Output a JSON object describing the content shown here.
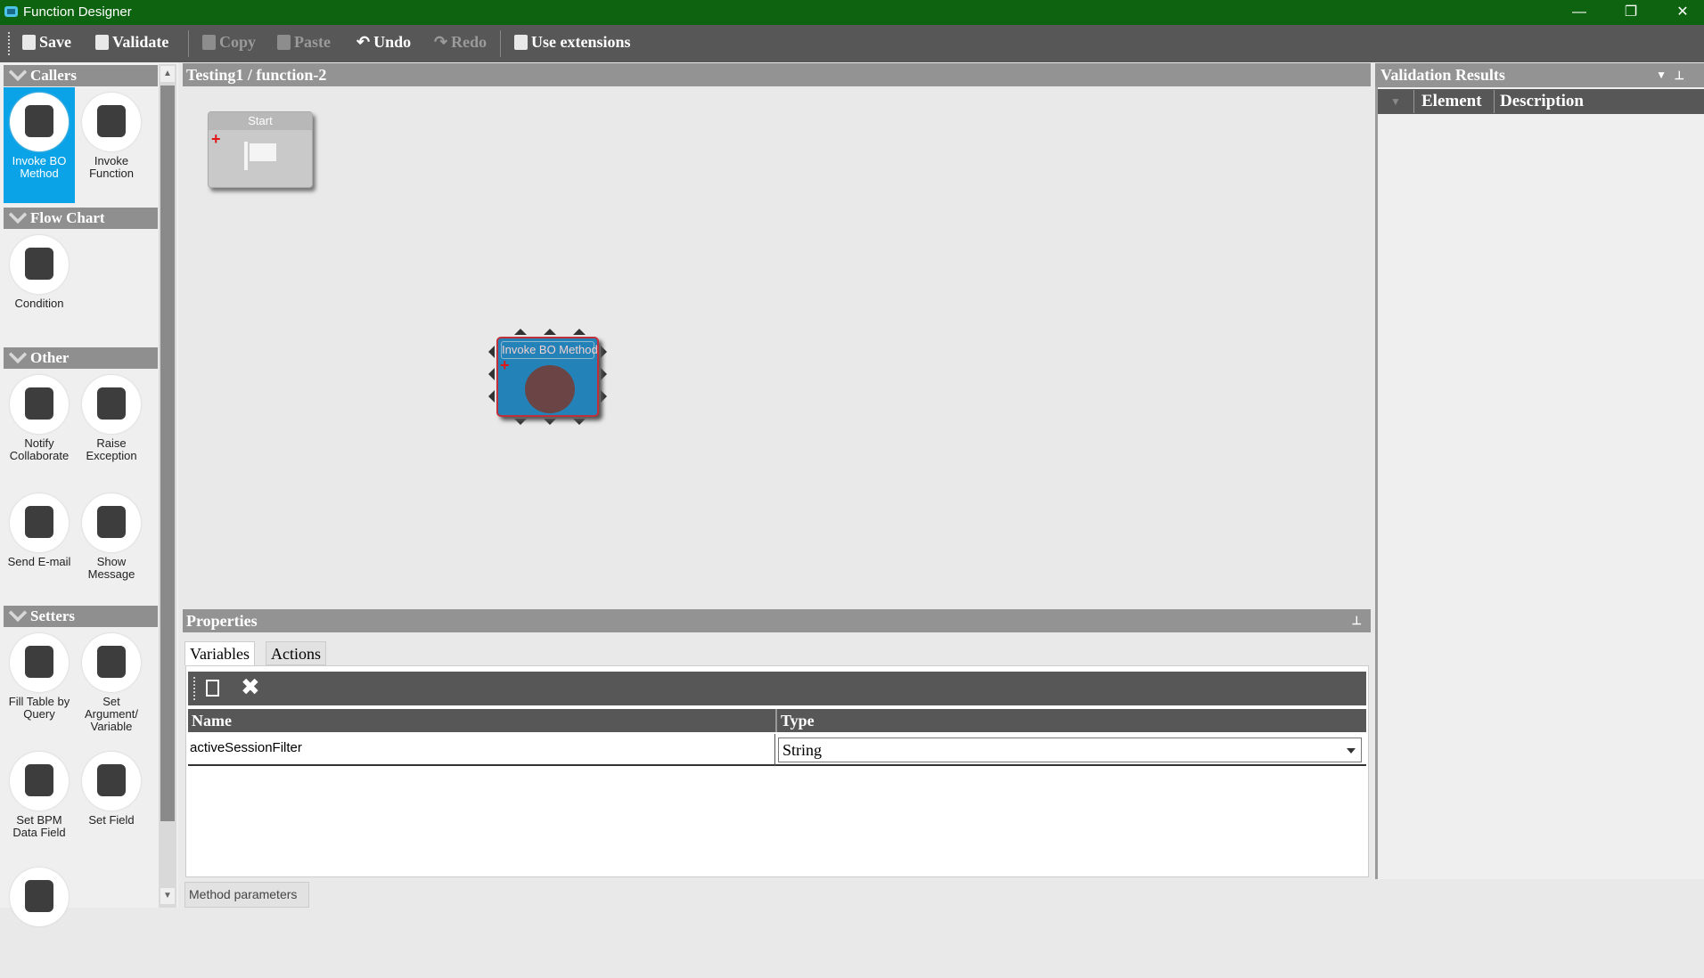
{
  "window": {
    "title": "Function Designer"
  },
  "toolbar": {
    "save": "Save",
    "validate": "Validate",
    "copy": "Copy",
    "paste": "Paste",
    "undo": "Undo",
    "redo": "Redo",
    "use_extensions": "Use extensions"
  },
  "palette": {
    "sections": [
      {
        "title": "Callers",
        "items": [
          "Invoke BO Method",
          "Invoke Function"
        ]
      },
      {
        "title": "Flow Chart",
        "items": [
          "Condition"
        ]
      },
      {
        "title": "Other",
        "items": [
          "Notify Collaborate",
          "Raise Exception",
          "Send E-mail",
          "Show Message"
        ]
      },
      {
        "title": "Setters",
        "items": [
          "Fill Table by Query",
          "Set Argument/ Variable",
          "Set BPM Data Field",
          "Set Field"
        ]
      }
    ]
  },
  "canvas": {
    "breadcrumb": "Testing1 / function-2",
    "nodes": {
      "start": "Start",
      "invoke": "Invoke BO Method"
    }
  },
  "properties": {
    "title": "Properties",
    "tabs": [
      "Variables",
      "Actions"
    ],
    "columns": [
      "Name",
      "Type"
    ],
    "rows": [
      {
        "name": "activeSessionFilter",
        "type": "String"
      }
    ]
  },
  "bottom_tab": "Method parameters",
  "validation": {
    "title": "Validation Results",
    "columns": [
      "Element",
      "Description"
    ]
  },
  "colors": {
    "titlebar": "#0d6310",
    "selected": "#0aa3e8",
    "node": "#2383b8"
  }
}
